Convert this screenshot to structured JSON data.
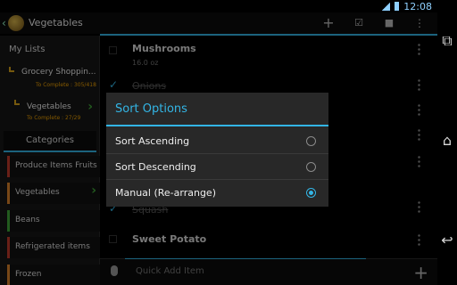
{
  "status": {
    "time": "12:08"
  },
  "actionbar": {
    "title": "Vegetables",
    "icons": [
      "add-icon",
      "checkbox-icon",
      "stop-icon",
      "overflow-menu-icon"
    ]
  },
  "sidebar": {
    "heading": "My Lists",
    "lists": [
      {
        "name": "Grocery Shoppin...",
        "sub": "To Complete : 305/418"
      },
      {
        "name": "Vegetables",
        "sub": "To Complete : 27/29"
      }
    ],
    "categories_label": "Categories",
    "categories": [
      {
        "name": "Produce Items Fruits",
        "color": "#c0392b"
      },
      {
        "name": "Vegetables",
        "color": "#d9822b"
      },
      {
        "name": "Beans",
        "color": "#3fa437"
      },
      {
        "name": "Refrigerated items",
        "color": "#c0392b"
      },
      {
        "name": "Frozen",
        "color": "#d9822b"
      }
    ]
  },
  "items": [
    {
      "name": "Mushrooms",
      "qty": "16.0 oz",
      "checked": false
    },
    {
      "name": "Onions",
      "checked": true
    },
    {
      "name": "Squash",
      "checked": true
    },
    {
      "name": "Sweet Potato",
      "checked": false
    }
  ],
  "quick_add": {
    "placeholder": "Quick Add Item"
  },
  "dialog": {
    "title": "Sort Options",
    "options": [
      {
        "label": "Sort Ascending",
        "selected": false
      },
      {
        "label": "Sort Descending",
        "selected": false
      },
      {
        "label": "Manual (Re-arrange)",
        "selected": true
      }
    ]
  },
  "colors": {
    "accent": "#33b5e5",
    "orange": "#f2a300",
    "green": "#3fa437"
  }
}
